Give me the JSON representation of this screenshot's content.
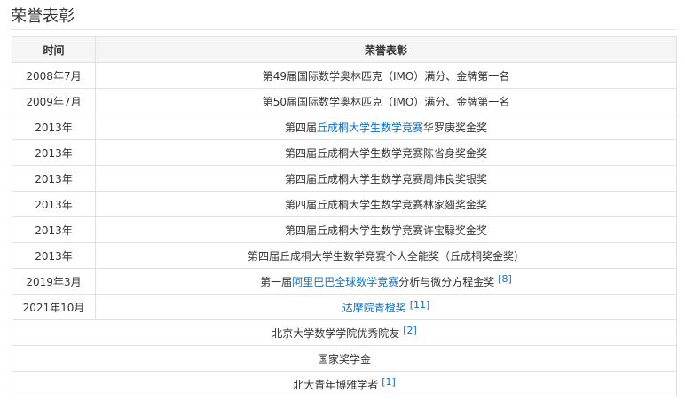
{
  "section": {
    "title": "荣誉表彰"
  },
  "table": {
    "headers": {
      "time": "时间",
      "honor": "荣誉表彰"
    },
    "rows": [
      {
        "time": "2008年7月",
        "honor": "第49届国际数学奥林匹克（IMO）满分、金牌第一名"
      },
      {
        "time": "2009年7月",
        "honor": "第50届国际数学奥林匹克（IMO）满分、金牌第一名"
      },
      {
        "time": "2013年",
        "pre": "第四届",
        "link": "丘成桐大学生数学竞赛",
        "post": "华罗庚奖金奖"
      },
      {
        "time": "2013年",
        "honor": "第四届丘成桐大学生数学竞赛陈省身奖金奖"
      },
      {
        "time": "2013年",
        "honor": "第四届丘成桐大学生数学竞赛周炜良奖银奖"
      },
      {
        "time": "2013年",
        "honor": "第四届丘成桐大学生数学竞赛林家翘奖金奖"
      },
      {
        "time": "2013年",
        "honor": "第四届丘成桐大学生数学竞赛许宝騄奖金奖"
      },
      {
        "time": "2013年",
        "honor": "第四届丘成桐大学生数学竞赛个人全能奖（丘成桐奖金奖）"
      },
      {
        "time": "2019年3月",
        "pre": "第一届",
        "link": "阿里巴巴全球数学竞赛",
        "post": "分析与微分方程金奖",
        "ref": "[8]"
      },
      {
        "time": "2021年10月",
        "link": "达摩院青橙奖",
        "ref": "[11]"
      }
    ],
    "full_rows": [
      {
        "honor": "北京大学数学学院优秀院友",
        "ref": "[2]"
      },
      {
        "honor": "国家奖学金"
      },
      {
        "honor": "北大青年博雅学者",
        "ref": "[1]"
      }
    ]
  }
}
